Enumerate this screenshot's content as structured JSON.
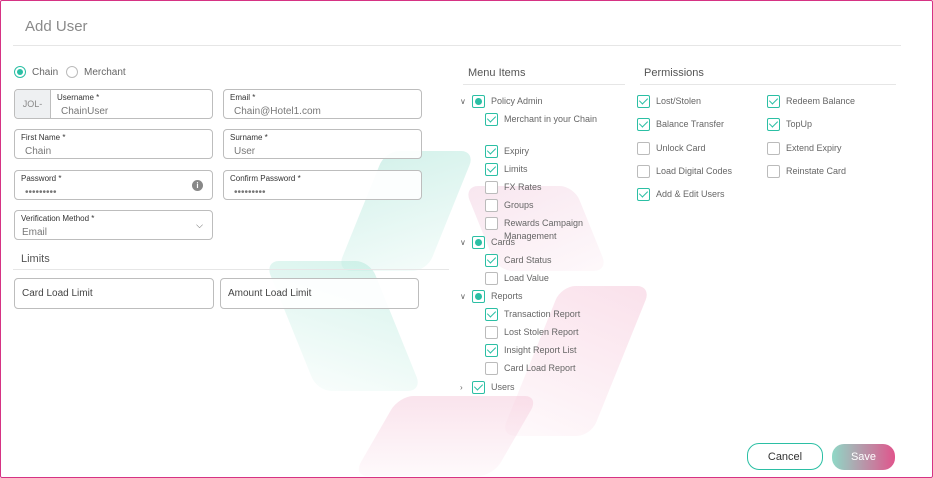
{
  "title": "Add User",
  "user_type": {
    "options": [
      {
        "label": "Chain",
        "selected": true
      },
      {
        "label": "Merchant",
        "selected": false
      }
    ]
  },
  "form": {
    "username": {
      "prefix": "JOL-",
      "label": "Username *",
      "value": "ChainUser"
    },
    "email": {
      "label": "Email *",
      "value": "Chain@Hotel1.com"
    },
    "first_name": {
      "label": "First Name *",
      "value": "Chain"
    },
    "surname": {
      "label": "Surname *",
      "value": "User"
    },
    "password": {
      "label": "Password *",
      "value": "•••••••••"
    },
    "confirm_password": {
      "label": "Confirm Password *",
      "value": "•••••••••"
    },
    "verification_method": {
      "label": "Verification Method *",
      "value": "Email"
    }
  },
  "limits": {
    "heading": "Limits",
    "card_load_limit": "Card Load Limit",
    "amount_load_limit": "Amount Load Limit"
  },
  "menu_items": {
    "heading": "Menu Items",
    "groups": [
      {
        "label": "Policy Admin",
        "state": "partial",
        "expanded": true,
        "children": [
          {
            "label": "Merchant in your Chain",
            "checked": true
          },
          {
            "label": "Expiry",
            "checked": true
          },
          {
            "label": "Limits",
            "checked": true
          },
          {
            "label": "FX Rates",
            "checked": false
          },
          {
            "label": "Groups",
            "checked": false
          },
          {
            "label": "Rewards Campaign Management",
            "checked": false
          }
        ]
      },
      {
        "label": "Cards",
        "state": "partial",
        "expanded": true,
        "children": [
          {
            "label": "Card Status",
            "checked": true
          },
          {
            "label": "Load Value",
            "checked": false
          }
        ]
      },
      {
        "label": "Reports",
        "state": "partial",
        "expanded": true,
        "children": [
          {
            "label": "Transaction Report",
            "checked": true
          },
          {
            "label": "Lost Stolen Report",
            "checked": false
          },
          {
            "label": "Insight Report List",
            "checked": true
          },
          {
            "label": "Card Load Report",
            "checked": false
          }
        ]
      },
      {
        "label": "Users",
        "state": "checked",
        "expanded": false,
        "children": []
      }
    ]
  },
  "permissions": {
    "heading": "Permissions",
    "left": [
      {
        "label": "Lost/Stolen",
        "checked": true
      },
      {
        "label": "Balance Transfer",
        "checked": true
      },
      {
        "label": "Unlock Card",
        "checked": false
      },
      {
        "label": "Load Digital Codes",
        "checked": false
      },
      {
        "label": "Add & Edit Users",
        "checked": true
      }
    ],
    "right": [
      {
        "label": "Redeem Balance",
        "checked": true
      },
      {
        "label": "TopUp",
        "checked": true
      },
      {
        "label": "Extend Expiry",
        "checked": false
      },
      {
        "label": "Reinstate Card",
        "checked": false
      }
    ]
  },
  "buttons": {
    "cancel": "Cancel",
    "save": "Save"
  },
  "colors": {
    "accent": "#2bbfa4",
    "brand_pink": "#e0558c",
    "border": "#d63384"
  }
}
